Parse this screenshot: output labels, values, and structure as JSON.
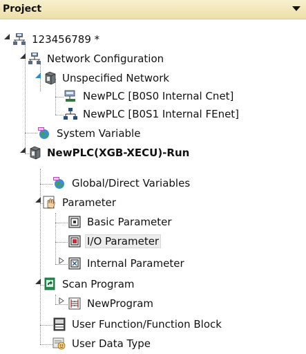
{
  "panel": {
    "title": "Project"
  },
  "tree": {
    "project": "123456789 *",
    "network_config": "Network Configuration",
    "unspecified_network": "Unspecified Network",
    "plc_cnet": "NewPLC [B0S0 Internal Cnet]",
    "plc_fenet": "NewPLC [B0S1 Internal FEnet]",
    "system_variable": "System Variable",
    "plc_run": "NewPLC(XGB-XECU)-Run",
    "global_vars": "Global/Direct Variables",
    "parameter": "Parameter",
    "basic_param": "Basic Parameter",
    "io_param": "I/O Parameter",
    "internal_param": "Internal Parameter",
    "scan_program": "Scan Program",
    "new_program": "NewProgram",
    "user_function": "User Function/Function Block",
    "user_data_type": "User Data Type"
  },
  "colors": {
    "header_top": "#f7f0cf",
    "header_bottom": "#ecdfa7",
    "selection": "#ececec"
  }
}
